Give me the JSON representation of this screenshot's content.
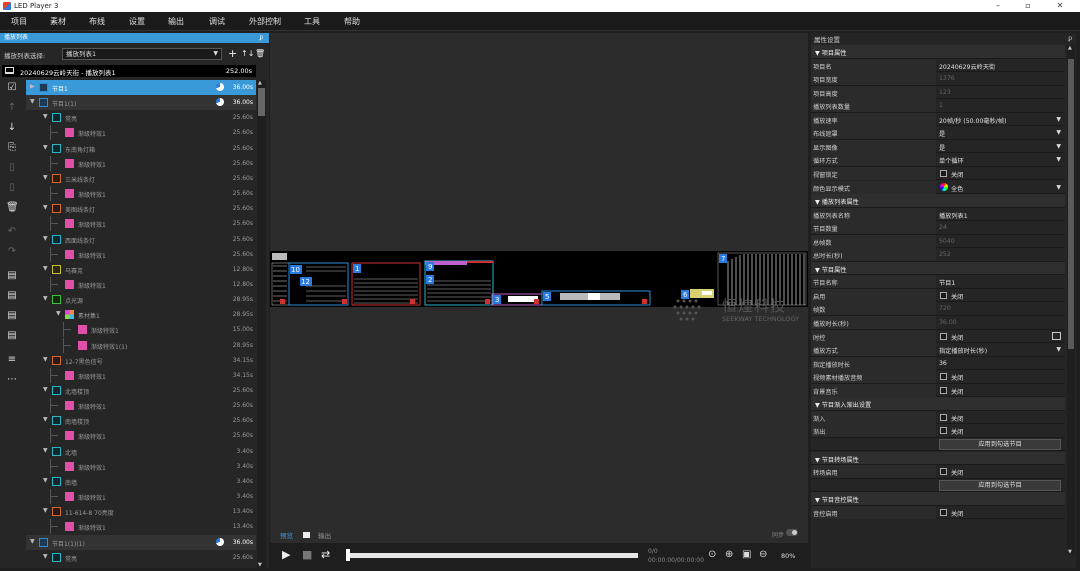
{
  "window": {
    "title": "LED Player 3",
    "minimize": "–",
    "maximize": "▫",
    "close": "✕"
  },
  "menu": [
    "项目",
    "素材",
    "布线",
    "设置",
    "输出",
    "调试",
    "外部控制",
    "工具",
    "帮助"
  ],
  "playlist_panel": {
    "header": "播放列表",
    "pin": "ᵱ",
    "select_label": "播放列表选择:",
    "select_value": "播放列表1",
    "add": "+",
    "sort": "↑↓",
    "delete": "🗑",
    "header_row": {
      "name": "20240629云岭天街 - 播放列表1",
      "duration": "252.00s"
    }
  },
  "tree": [
    {
      "indent": 0,
      "kind": "selected",
      "icon": "prog",
      "label": "节目1",
      "dur": "36.00s",
      "pie": true,
      "tri": "▶"
    },
    {
      "indent": 0,
      "kind": "group",
      "icon": "prog",
      "label": "节目1(1)",
      "dur": "36.00s",
      "pie": true,
      "tri": "▼"
    },
    {
      "indent": 1,
      "icon": "light",
      "label": "常亮",
      "dur": "25.60s",
      "tri": "▼"
    },
    {
      "indent": 2,
      "icon": "fx",
      "label": "渐级特效1",
      "dur": "25.60s"
    },
    {
      "indent": 1,
      "icon": "light",
      "label": "东南角灯箱",
      "dur": "25.60s",
      "tri": "▼"
    },
    {
      "indent": 2,
      "icon": "fx",
      "label": "渐级特效1",
      "dur": "25.60s"
    },
    {
      "indent": 1,
      "icon": "bar",
      "label": "三米线条灯",
      "dur": "25.60s",
      "tri": "▼"
    },
    {
      "indent": 2,
      "icon": "fx",
      "label": "渐级特效1",
      "dur": "25.60s"
    },
    {
      "indent": 1,
      "icon": "bar",
      "label": "美图线条灯",
      "dur": "25.60s",
      "tri": "▼"
    },
    {
      "indent": 2,
      "icon": "fx",
      "label": "渐级特效1",
      "dur": "25.60s"
    },
    {
      "indent": 1,
      "icon": "light",
      "label": "西面线条灯",
      "dur": "25.60s",
      "tri": "▼"
    },
    {
      "indent": 2,
      "icon": "fx",
      "label": "渐级特效1",
      "dur": "25.60s"
    },
    {
      "indent": 1,
      "icon": "src",
      "label": "马赛克",
      "dur": "12.80s",
      "tri": "▼"
    },
    {
      "indent": 2,
      "icon": "fx",
      "label": "渐级特效1",
      "dur": "12.80s"
    },
    {
      "indent": 1,
      "icon": "pt",
      "label": "点光源",
      "dur": "28.95s",
      "tri": "▼"
    },
    {
      "indent": 2,
      "icon": "mat",
      "label": "素材集1",
      "dur": "28.95s",
      "tri": "▼"
    },
    {
      "indent": 3,
      "icon": "fx",
      "label": "渐级特效1",
      "dur": "15.00s"
    },
    {
      "indent": 3,
      "icon": "fx",
      "label": "渐级特效1(1)",
      "dur": "28.95s"
    },
    {
      "indent": 1,
      "icon": "bar",
      "label": "12-7黑色信号",
      "dur": "34.15s",
      "tri": "▼"
    },
    {
      "indent": 2,
      "icon": "fx",
      "label": "渐级特效1",
      "dur": "34.15s"
    },
    {
      "indent": 1,
      "icon": "light",
      "label": "北墙楼顶",
      "dur": "25.60s",
      "tri": "▼"
    },
    {
      "indent": 2,
      "icon": "fx",
      "label": "渐级特效1",
      "dur": "25.60s"
    },
    {
      "indent": 1,
      "icon": "light",
      "label": "南墙楼顶",
      "dur": "25.60s",
      "tri": "▼"
    },
    {
      "indent": 2,
      "icon": "fx",
      "label": "渐级特效1",
      "dur": "25.60s"
    },
    {
      "indent": 1,
      "icon": "light",
      "label": "北墙",
      "dur": "3.40s",
      "tri": "▼"
    },
    {
      "indent": 2,
      "icon": "fx",
      "label": "渐级特效1",
      "dur": "3.40s"
    },
    {
      "indent": 1,
      "icon": "light",
      "label": "南墙",
      "dur": "3.40s",
      "tri": "▼"
    },
    {
      "indent": 2,
      "icon": "fx",
      "label": "渐级特效1",
      "dur": "3.40s"
    },
    {
      "indent": 1,
      "icon": "bar",
      "label": "11-614-8 70亮度",
      "dur": "13.40s",
      "tri": "▼"
    },
    {
      "indent": 2,
      "icon": "fx",
      "label": "渐级特效1",
      "dur": "13.40s"
    },
    {
      "indent": 0,
      "kind": "group",
      "icon": "prog",
      "label": "节目1(1)(1)",
      "dur": "36.00s",
      "pie": true,
      "tri": "▼"
    },
    {
      "indent": 1,
      "icon": "light",
      "label": "常亮",
      "dur": "25.60s",
      "tri": "▼"
    }
  ],
  "preview": {
    "tab_preview": "预览",
    "tab_output": "输出",
    "sync_label": "同步",
    "frame_count": "0/0",
    "timecode": "00:00:00/00:00:00",
    "zoom": "80%",
    "watermark_cn": "恒煌科技",
    "watermark_en": "SEEKWAY TECHNOLOGY",
    "fixture_labels": [
      "10",
      "12",
      "1",
      "9",
      "2",
      "3",
      "5",
      "6",
      "7"
    ]
  },
  "properties": {
    "header": "属性设置",
    "rows": [
      {
        "type": "section",
        "k": "▼ 项目属性"
      },
      {
        "k": "项目名",
        "v": "20240629云岭天街"
      },
      {
        "k": "项目宽度",
        "v": "1376",
        "dim": true
      },
      {
        "k": "项目高度",
        "v": "123",
        "dim": true
      },
      {
        "k": "播放列表数量",
        "v": "1",
        "dim": true
      },
      {
        "k": "播放速率",
        "v": "20帧/秒 (50.00毫秒/帧)",
        "dd": true
      },
      {
        "k": "布线遮罩",
        "v": "是",
        "dd": true
      },
      {
        "k": "显示图像",
        "v": "是",
        "dd": true
      },
      {
        "k": "循环方式",
        "v": "单个循环",
        "dd": true
      },
      {
        "k": "视窗锁定",
        "v": "关闭",
        "chk": true
      },
      {
        "k": "颜色显示模式",
        "v": "全色",
        "dd": true,
        "wheel": true
      },
      {
        "type": "section",
        "k": "▼ 播放列表属性"
      },
      {
        "k": "播放列表名称",
        "v": "播放列表1"
      },
      {
        "k": "节目数量",
        "v": "24",
        "dim": true
      },
      {
        "k": "总帧数",
        "v": "5040",
        "dim": true
      },
      {
        "k": "总时长(秒)",
        "v": "252",
        "dim": true
      },
      {
        "type": "section",
        "k": "▼ 节目属性"
      },
      {
        "k": "节目名称",
        "v": "节目1"
      },
      {
        "k": "启用",
        "v": "关闭",
        "chk": true
      },
      {
        "k": "帧数",
        "v": "720",
        "dim": true
      },
      {
        "k": "播放时长(秒)",
        "v": "36.00",
        "dim": true
      },
      {
        "k": "时控",
        "v": "关闭",
        "chk": true,
        "cal": true
      },
      {
        "k": "播放方式",
        "v": "指定播放时长(秒)",
        "dd": true
      },
      {
        "k": "指定播放时长",
        "v": "36"
      },
      {
        "k": "视频素材播放音频",
        "v": "关闭",
        "chk": true
      },
      {
        "k": "背景音乐",
        "v": "关闭",
        "chk": true
      },
      {
        "type": "section",
        "k": "▼ 节目渐入渐出设置"
      },
      {
        "k": "渐入",
        "v": "关闭",
        "chk": true
      },
      {
        "k": "渐出",
        "v": "关闭",
        "chk": true
      },
      {
        "type": "button",
        "v": "应用到勾选节目"
      },
      {
        "type": "section",
        "k": "▼ 节目转场属性"
      },
      {
        "k": "转场启用",
        "v": "关闭",
        "chk": true
      },
      {
        "type": "button",
        "v": "应用到勾选节目"
      },
      {
        "type": "section",
        "k": "▼ 节目音控属性"
      },
      {
        "k": "音控启用",
        "v": "关闭",
        "chk": true
      }
    ]
  }
}
